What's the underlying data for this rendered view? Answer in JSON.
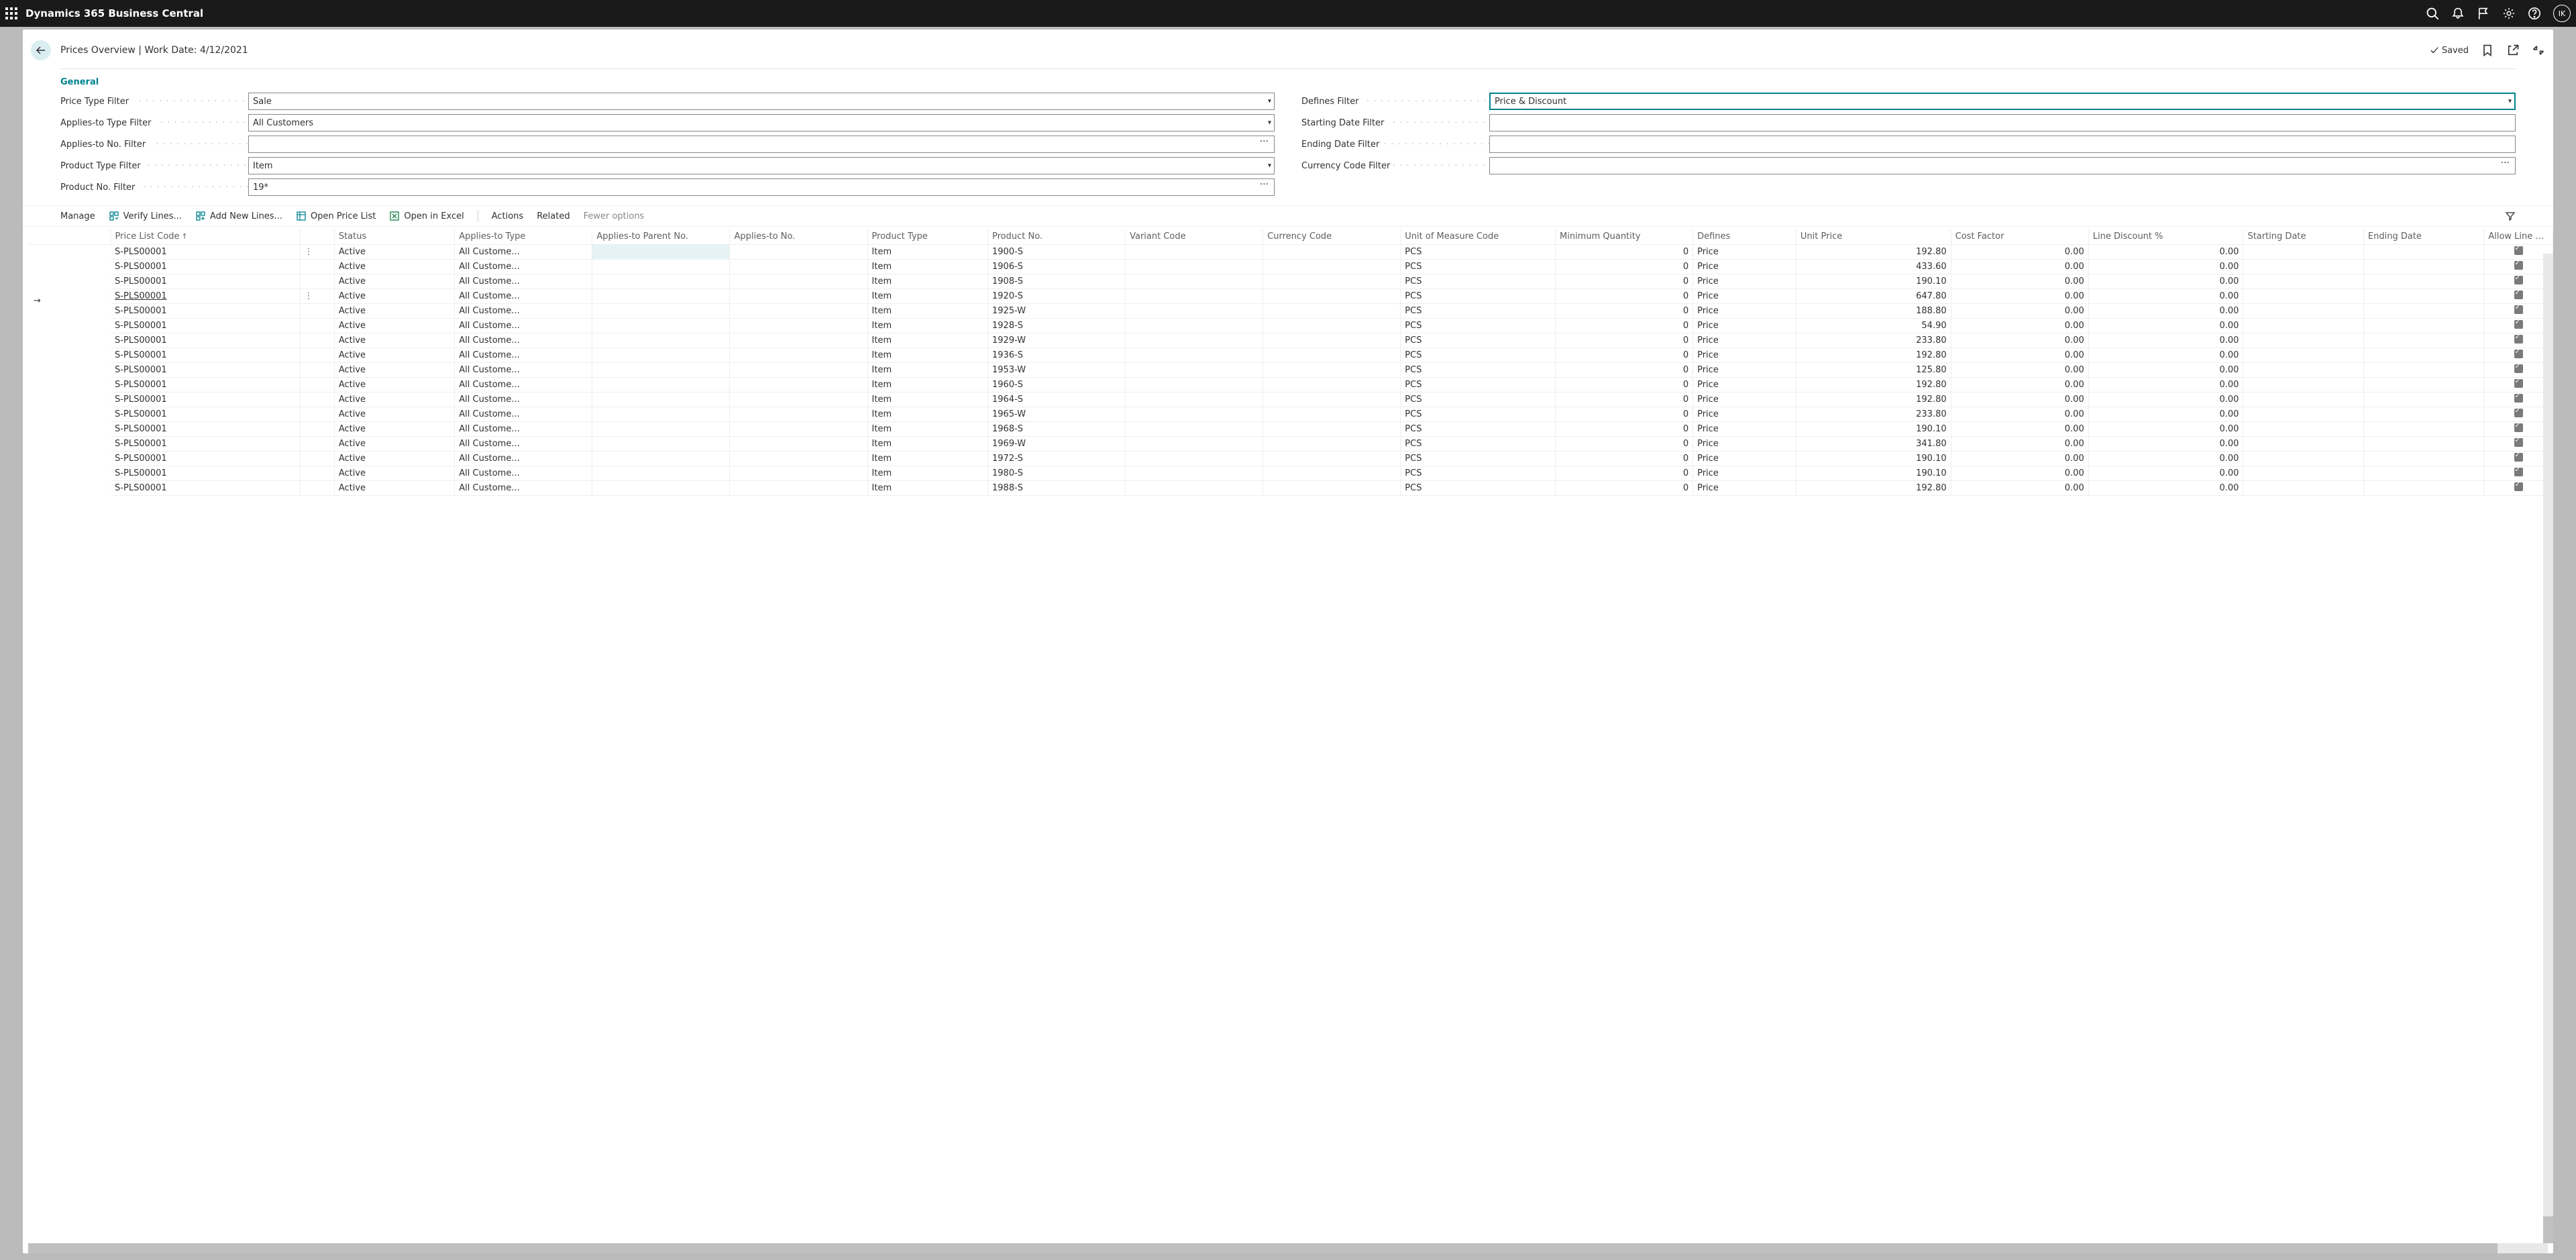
{
  "topbar": {
    "title": "Dynamics 365 Business Central",
    "user_initials": "IK"
  },
  "header": {
    "title": "Prices Overview | Work Date: 4/12/2021",
    "saved_label": "Saved"
  },
  "section_title": "General",
  "filters": {
    "left": [
      {
        "label": "Price Type Filter",
        "value": "Sale",
        "kind": "select"
      },
      {
        "label": "Applies-to Type Filter",
        "value": "All Customers",
        "kind": "select"
      },
      {
        "label": "Applies-to No. Filter",
        "value": "",
        "kind": "lookup"
      },
      {
        "label": "Product Type Filter",
        "value": "Item",
        "kind": "select"
      },
      {
        "label": "Product No. Filter",
        "value": "19*",
        "kind": "lookup"
      }
    ],
    "right": [
      {
        "label": "Defines Filter",
        "value": "Price & Discount",
        "kind": "select",
        "focused": true
      },
      {
        "label": "Starting Date Filter",
        "value": "",
        "kind": "text"
      },
      {
        "label": "Ending Date Filter",
        "value": "",
        "kind": "text"
      },
      {
        "label": "Currency Code Filter",
        "value": "",
        "kind": "lookup"
      }
    ]
  },
  "toolbar": {
    "manage": "Manage",
    "verify": "Verify Lines...",
    "addnew": "Add New Lines...",
    "openlist": "Open Price List",
    "excel": "Open in Excel",
    "actions": "Actions",
    "related": "Related",
    "fewer": "Fewer options"
  },
  "columns": [
    {
      "key": "code",
      "label": "Price List Code",
      "w": 110,
      "sorted": true
    },
    {
      "key": "menu",
      "label": "",
      "w": 20
    },
    {
      "key": "status",
      "label": "Status",
      "w": 70
    },
    {
      "key": "apptype",
      "label": "Applies-to Type",
      "w": 80
    },
    {
      "key": "appparent",
      "label": "Applies-to Parent No.",
      "w": 80
    },
    {
      "key": "appno",
      "label": "Applies-to No.",
      "w": 80
    },
    {
      "key": "ptype",
      "label": "Product Type",
      "w": 70
    },
    {
      "key": "pno",
      "label": "Product No.",
      "w": 80
    },
    {
      "key": "variant",
      "label": "Variant Code",
      "w": 80
    },
    {
      "key": "currency",
      "label": "Currency Code",
      "w": 80
    },
    {
      "key": "uom",
      "label": "Unit of Measure Code",
      "w": 90
    },
    {
      "key": "minqty",
      "label": "Minimum Quantity",
      "w": 80,
      "num": true
    },
    {
      "key": "defines",
      "label": "Defines",
      "w": 60
    },
    {
      "key": "unitprice",
      "label": "Unit Price",
      "w": 90,
      "num": true
    },
    {
      "key": "costfactor",
      "label": "Cost Factor",
      "w": 80,
      "num": true
    },
    {
      "key": "linedisc",
      "label": "Line Discount %",
      "w": 90,
      "num": true
    },
    {
      "key": "sdate",
      "label": "Starting Date",
      "w": 70
    },
    {
      "key": "edate",
      "label": "Ending Date",
      "w": 70
    },
    {
      "key": "allowdisc",
      "label": "Allow Line Disc.",
      "w": 40,
      "chk": true
    }
  ],
  "rows": [
    {
      "code": "S-PLS00001",
      "status": "Active",
      "apptype": "All Custome...",
      "ptype": "Item",
      "pno": "1900-S",
      "uom": "PCS",
      "minqty": "0",
      "defines": "Price",
      "unitprice": "192.80",
      "costfactor": "0.00",
      "linedisc": "0.00",
      "sel": true,
      "menu": true
    },
    {
      "code": "S-PLS00001",
      "status": "Active",
      "apptype": "All Custome...",
      "ptype": "Item",
      "pno": "1906-S",
      "uom": "PCS",
      "minqty": "0",
      "defines": "Price",
      "unitprice": "433.60",
      "costfactor": "0.00",
      "linedisc": "0.00"
    },
    {
      "code": "S-PLS00001",
      "status": "Active",
      "apptype": "All Custome...",
      "ptype": "Item",
      "pno": "1908-S",
      "uom": "PCS",
      "minqty": "0",
      "defines": "Price",
      "unitprice": "190.10",
      "costfactor": "0.00",
      "linedisc": "0.00"
    },
    {
      "code": "S-PLS00001",
      "status": "Active",
      "apptype": "All Custome...",
      "ptype": "Item",
      "pno": "1920-S",
      "uom": "PCS",
      "minqty": "0",
      "defines": "Price",
      "unitprice": "647.80",
      "costfactor": "0.00",
      "linedisc": "0.00",
      "current": true,
      "menu": true
    },
    {
      "code": "S-PLS00001",
      "status": "Active",
      "apptype": "All Custome...",
      "ptype": "Item",
      "pno": "1925-W",
      "uom": "PCS",
      "minqty": "0",
      "defines": "Price",
      "unitprice": "188.80",
      "costfactor": "0.00",
      "linedisc": "0.00"
    },
    {
      "code": "S-PLS00001",
      "status": "Active",
      "apptype": "All Custome...",
      "ptype": "Item",
      "pno": "1928-S",
      "uom": "PCS",
      "minqty": "0",
      "defines": "Price",
      "unitprice": "54.90",
      "costfactor": "0.00",
      "linedisc": "0.00"
    },
    {
      "code": "S-PLS00001",
      "status": "Active",
      "apptype": "All Custome...",
      "ptype": "Item",
      "pno": "1929-W",
      "uom": "PCS",
      "minqty": "0",
      "defines": "Price",
      "unitprice": "233.80",
      "costfactor": "0.00",
      "linedisc": "0.00"
    },
    {
      "code": "S-PLS00001",
      "status": "Active",
      "apptype": "All Custome...",
      "ptype": "Item",
      "pno": "1936-S",
      "uom": "PCS",
      "minqty": "0",
      "defines": "Price",
      "unitprice": "192.80",
      "costfactor": "0.00",
      "linedisc": "0.00"
    },
    {
      "code": "S-PLS00001",
      "status": "Active",
      "apptype": "All Custome...",
      "ptype": "Item",
      "pno": "1953-W",
      "uom": "PCS",
      "minqty": "0",
      "defines": "Price",
      "unitprice": "125.80",
      "costfactor": "0.00",
      "linedisc": "0.00"
    },
    {
      "code": "S-PLS00001",
      "status": "Active",
      "apptype": "All Custome...",
      "ptype": "Item",
      "pno": "1960-S",
      "uom": "PCS",
      "minqty": "0",
      "defines": "Price",
      "unitprice": "192.80",
      "costfactor": "0.00",
      "linedisc": "0.00"
    },
    {
      "code": "S-PLS00001",
      "status": "Active",
      "apptype": "All Custome...",
      "ptype": "Item",
      "pno": "1964-S",
      "uom": "PCS",
      "minqty": "0",
      "defines": "Price",
      "unitprice": "192.80",
      "costfactor": "0.00",
      "linedisc": "0.00"
    },
    {
      "code": "S-PLS00001",
      "status": "Active",
      "apptype": "All Custome...",
      "ptype": "Item",
      "pno": "1965-W",
      "uom": "PCS",
      "minqty": "0",
      "defines": "Price",
      "unitprice": "233.80",
      "costfactor": "0.00",
      "linedisc": "0.00"
    },
    {
      "code": "S-PLS00001",
      "status": "Active",
      "apptype": "All Custome...",
      "ptype": "Item",
      "pno": "1968-S",
      "uom": "PCS",
      "minqty": "0",
      "defines": "Price",
      "unitprice": "190.10",
      "costfactor": "0.00",
      "linedisc": "0.00"
    },
    {
      "code": "S-PLS00001",
      "status": "Active",
      "apptype": "All Custome...",
      "ptype": "Item",
      "pno": "1969-W",
      "uom": "PCS",
      "minqty": "0",
      "defines": "Price",
      "unitprice": "341.80",
      "costfactor": "0.00",
      "linedisc": "0.00"
    },
    {
      "code": "S-PLS00001",
      "status": "Active",
      "apptype": "All Custome...",
      "ptype": "Item",
      "pno": "1972-S",
      "uom": "PCS",
      "minqty": "0",
      "defines": "Price",
      "unitprice": "190.10",
      "costfactor": "0.00",
      "linedisc": "0.00"
    },
    {
      "code": "S-PLS00001",
      "status": "Active",
      "apptype": "All Custome...",
      "ptype": "Item",
      "pno": "1980-S",
      "uom": "PCS",
      "minqty": "0",
      "defines": "Price",
      "unitprice": "190.10",
      "costfactor": "0.00",
      "linedisc": "0.00"
    },
    {
      "code": "S-PLS00001",
      "status": "Active",
      "apptype": "All Custome...",
      "ptype": "Item",
      "pno": "1988-S",
      "uom": "PCS",
      "minqty": "0",
      "defines": "Price",
      "unitprice": "192.80",
      "costfactor": "0.00",
      "linedisc": "0.00"
    }
  ]
}
